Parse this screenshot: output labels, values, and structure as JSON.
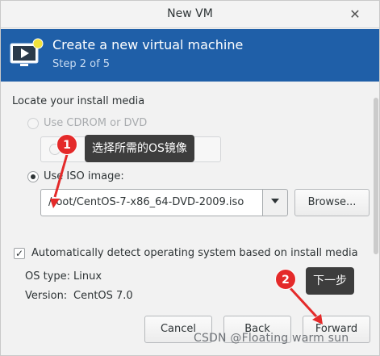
{
  "window": {
    "title": "New VM",
    "close_icon": "close-icon"
  },
  "header": {
    "title": "Create a new virtual machine",
    "step": "Step 2 of 5",
    "icon": "vm-wizard-icon"
  },
  "install_media": {
    "section_label": "Locate your install media",
    "cdrom_option": "Use CDROM or DVD",
    "iso_option": "Use ISO image:",
    "iso_path": "/root/CentOS-7-x86_64-DVD-2009.iso",
    "browse_label": "Browse..."
  },
  "os_detect": {
    "checkbox_label": "Automatically detect operating system based on install media",
    "checked": true,
    "type_label": "OS type:",
    "type_value": "Linux",
    "version_label": "Version:",
    "version_value": "CentOS 7.0"
  },
  "footer": {
    "cancel_label": "Cancel",
    "back_label": "Back",
    "forward_label": "Forward"
  },
  "annotations": {
    "badge1": "1",
    "tooltip1": "选择所需的OS镜像",
    "badge2": "2",
    "tooltip2": "下一步",
    "accent_color": "#e42a2a"
  },
  "watermark": "CSDN @Floating warm sun"
}
